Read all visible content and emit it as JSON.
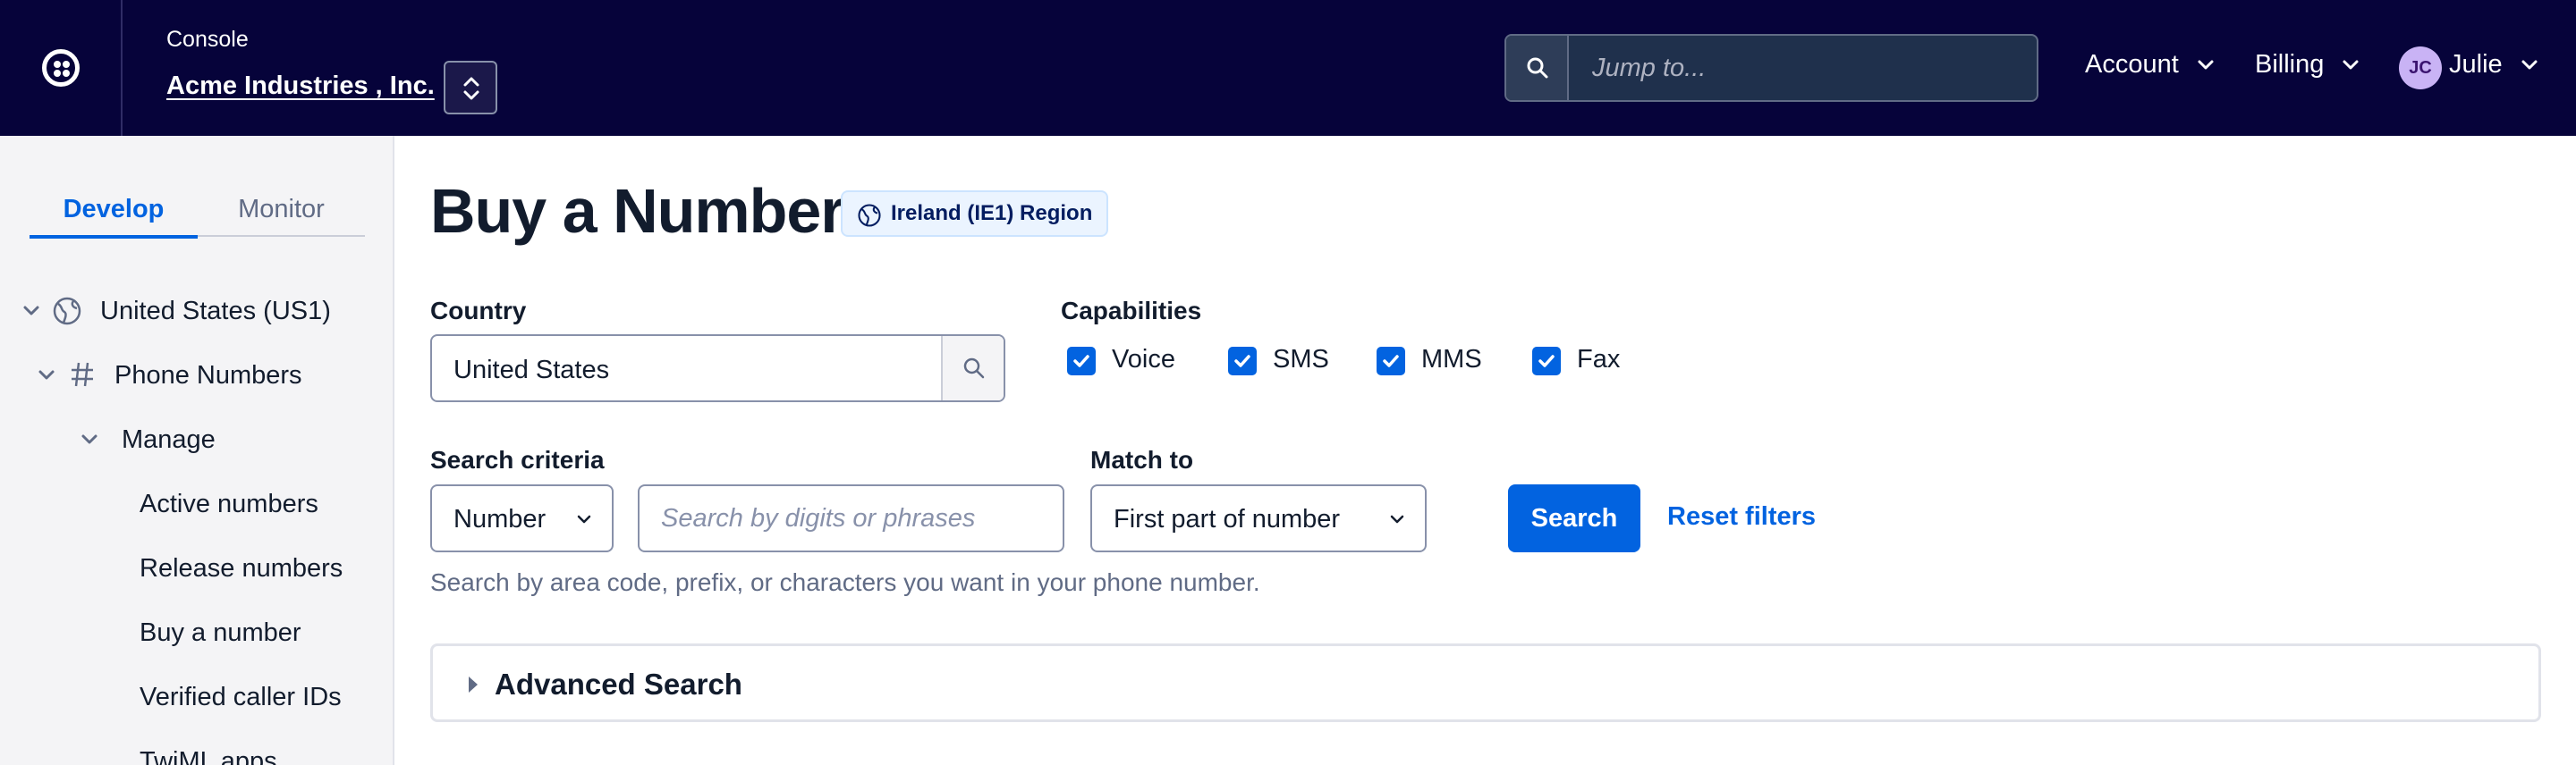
{
  "topbar": {
    "console_label": "Console",
    "account_name": "Acme Industries , Inc.",
    "jump_placeholder": "Jump to...",
    "menus": [
      "Account",
      "Billing"
    ],
    "user": {
      "initials": "JC",
      "name": "Julie"
    }
  },
  "sidebar": {
    "tabs": [
      "Develop",
      "Monitor"
    ],
    "active_tab": "Develop",
    "tree": {
      "region": "United States (US1)",
      "section": "Phone Numbers",
      "group": "Manage",
      "items": [
        "Active numbers",
        "Release numbers",
        "Buy a number",
        "Verified caller IDs",
        "TwiML apps"
      ]
    }
  },
  "main": {
    "title": "Buy a Number",
    "region_badge": "Ireland (IE1) Region",
    "country": {
      "label": "Country",
      "value": "United States"
    },
    "capabilities": {
      "label": "Capabilities",
      "options": [
        {
          "label": "Voice",
          "checked": true
        },
        {
          "label": "SMS",
          "checked": true
        },
        {
          "label": "MMS",
          "checked": true
        },
        {
          "label": "Fax",
          "checked": true
        }
      ]
    },
    "search_criteria": {
      "label": "Search criteria",
      "type_value": "Number",
      "placeholder": "Search by digits or phrases"
    },
    "match_to": {
      "label": "Match to",
      "value": "First part of number"
    },
    "search_button": "Search",
    "reset_link": "Reset filters",
    "help_text": "Search by area code, prefix, or characters you want in your phone number.",
    "advanced_search": "Advanced Search"
  },
  "colors": {
    "topbar_bg": "#06033a",
    "primary": "#0263e0",
    "sidebar_bg": "#f4f4f6",
    "badge_bg": "#ebf4ff"
  }
}
